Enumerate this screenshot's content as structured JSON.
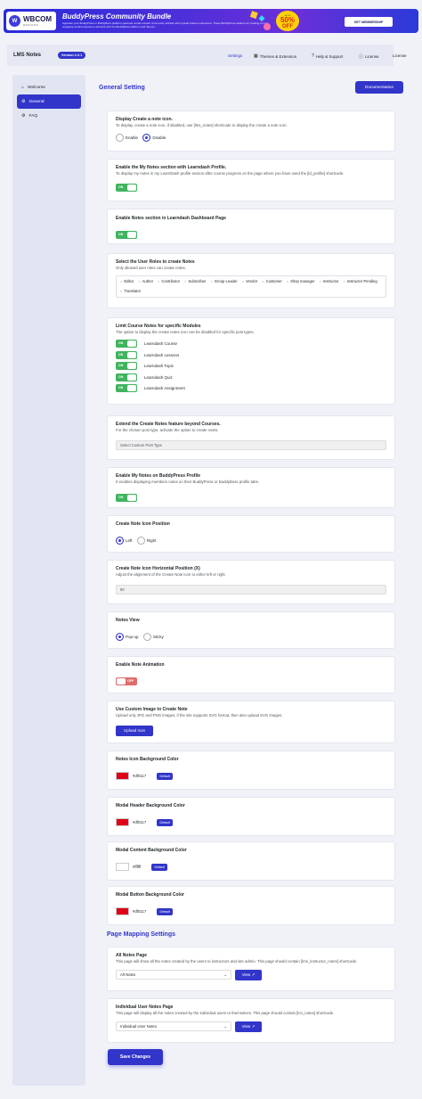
{
  "banner": {
    "logo_big": "WBCOM",
    "logo_small": "DESIGNS",
    "title": "BuddyPress Community Bundle",
    "description": "Appraise your BuddyPress or BuddyBoss platform-powered social network community website with popular feature extensions. These BuddyPress addons for creating a more engaging social experience will work with the BuddyBoss platform and themes.",
    "offer_up_to": "up to",
    "offer_percent": "50%",
    "offer_off": "OFF",
    "cta": "GET MEMBERSHIP"
  },
  "header": {
    "title": "LMS Notes",
    "version": "Version 2.2.1",
    "nav": [
      "Settings",
      "Themes & Extension",
      "Help & Support",
      "License",
      "License"
    ]
  },
  "sidebar": {
    "items": [
      {
        "label": "Welcome",
        "icon": "home-icon"
      },
      {
        "label": "General",
        "icon": "gear-icon"
      },
      {
        "label": "FAQ",
        "icon": "gears-icon"
      }
    ]
  },
  "main": {
    "title": "General Setting",
    "documentation": "Documentation"
  },
  "settings": {
    "display_icon": {
      "label": "Display Create a note icon.",
      "desc": "To display, create a note icon, if disabled, use [lms_notes] shortcode to display the create a note icon.",
      "options": [
        "Enable",
        "Disable"
      ],
      "selected": "Disable"
    },
    "ld_profile": {
      "label": "Enable the My Notes section with Learndash Profile.",
      "desc": "To display my notes in my LearnDash profile section after course progress on the page where you have used the [ld_profile] shortcode.",
      "toggle": "ON"
    },
    "ld_dashboard": {
      "label": "Enable Notes section in Learndash Dashboard Page",
      "toggle": "ON"
    },
    "user_roles": {
      "label": "Select the User Roles to create Notes",
      "desc": "Only allowed user roles can create notes.",
      "tags": [
        "Editor",
        "Author",
        "Contributor",
        "Subscriber",
        "Group Leader",
        "Vendor",
        "Customer",
        "Shop manager",
        "Instructor",
        "Instructor Pending",
        "Translator"
      ]
    },
    "limit_modules": {
      "label": "Limit Course Notes for specific Modules",
      "desc": "The option to display the create notes icon can be disabled for specific post types.",
      "toggle": "ON",
      "items": [
        "Learndash Course",
        "Learndash Lessons",
        "Learndash Topic",
        "Learndash Quiz",
        "Learndash Assignment"
      ]
    },
    "extend_courses": {
      "label": "Extend the Create Notes feature beyond Courses.",
      "desc": "For the chosen post type, activate the option to create notes.",
      "placeholder": "Select Custom Post Type"
    },
    "bp_profile": {
      "label": "Enable My Notes on BuddyPress Profile",
      "desc": "It enables displaying members notes on their BuddyPress or BuddyBoss profile tabs.",
      "toggle": "ON"
    },
    "icon_position": {
      "label": "Create Note Icon Position",
      "options": [
        "Left",
        "Right"
      ],
      "selected": "Left"
    },
    "horizontal_position": {
      "label": "Create Note Icon Horizontal Position (X)",
      "desc": "Adjust the alignment of the Create Note icon to either left or right.",
      "value": "80"
    },
    "notes_view": {
      "label": "Notes View",
      "options": [
        "Pop-up",
        "Sticky"
      ],
      "selected": "Pop-up"
    },
    "animation": {
      "label": "Enable Note Animation",
      "toggle": "OFF"
    },
    "custom_image": {
      "label": "Use Custom Image to Create Note",
      "desc": "Upload only JPG and PNG images; if the site supports SVG format, then also upload SVG images.",
      "button": "Upload Icon"
    },
    "colors": [
      {
        "label": "Notes Icon Background Color",
        "hex": "#df0117",
        "color": "#df0117",
        "button": "Default"
      },
      {
        "label": "Modal Header Background Color",
        "hex": "#df0117",
        "color": "#df0117",
        "button": "Default"
      },
      {
        "label": "Modal Content Background Color",
        "hex": "#ffffff",
        "color": "#ffffff",
        "button": "Default"
      },
      {
        "label": "Modal Button Background Color",
        "hex": "#df0117",
        "color": "#df0117",
        "button": "Default"
      }
    ]
  },
  "page_mapping": {
    "title": "Page Mapping Settings",
    "all_notes": {
      "label": "All Notes Page",
      "desc": "This page will show all the notes created by the users to instructors and site admin. This page should contain [lms_instructor_notes] shortcode.",
      "selected": "All Notes",
      "button": "View"
    },
    "user_notes": {
      "label": "Individual User Notes Page",
      "desc": "This page will display all the notes created by the individual users to themselves. This page should contain [lcn_notes] shortcode.",
      "selected": "Individual User Notes",
      "button": "View"
    }
  },
  "save_button": "Save Changes"
}
